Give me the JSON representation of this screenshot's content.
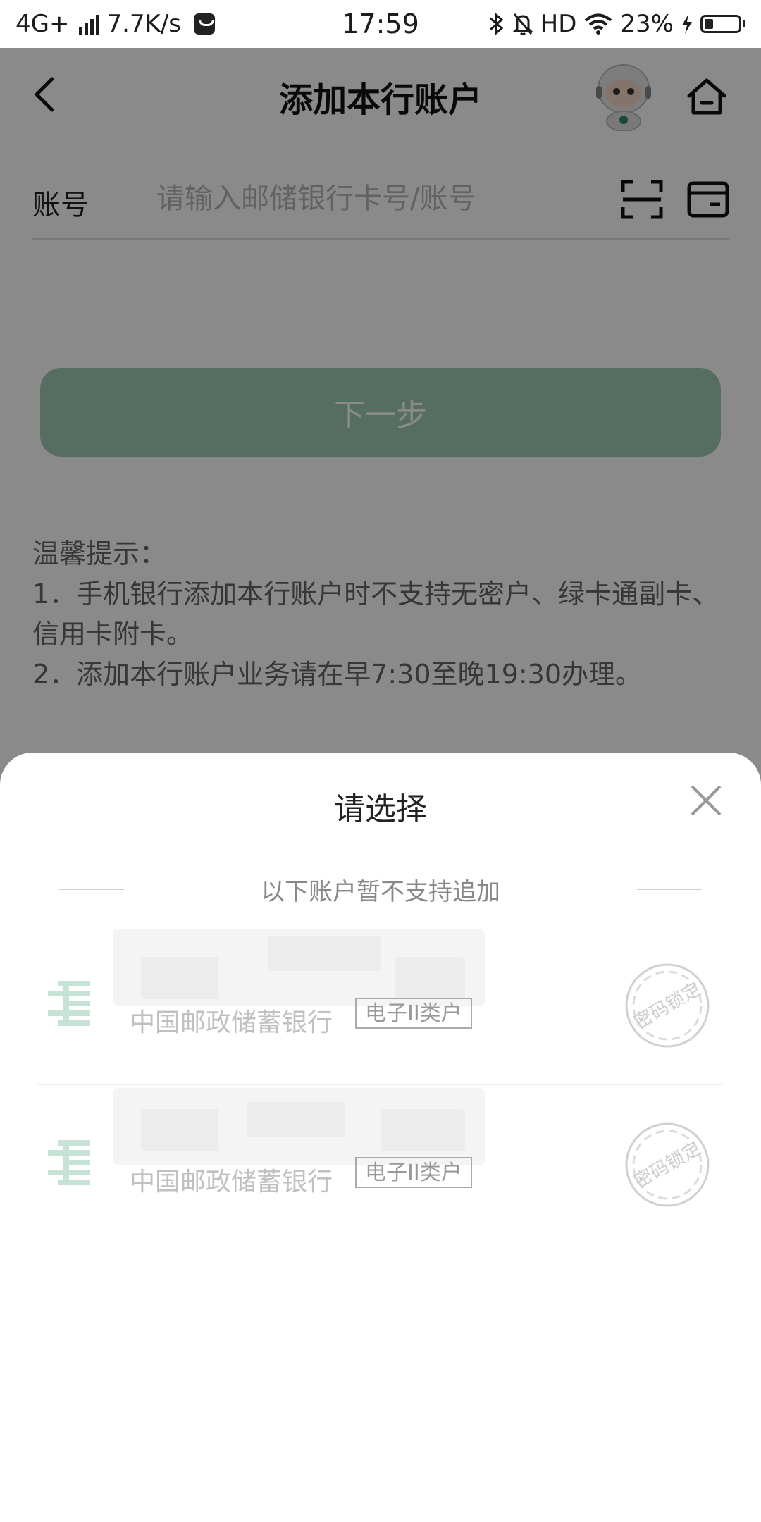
{
  "status_bar": {
    "network": "4G+",
    "speed": "7.7K/s",
    "time": "17:59",
    "hd": "HD",
    "battery": "23%",
    "icons": [
      "signal-icon",
      "message-icon",
      "bluetooth-icon",
      "mute-icon",
      "wifi-icon",
      "charging-icon",
      "battery-icon"
    ]
  },
  "header": {
    "title": "添加本行账户",
    "back_icon": "chevron-left-icon",
    "assistant_icon": "robot-assistant-icon",
    "home_icon": "home-icon"
  },
  "account_field": {
    "label": "账号",
    "placeholder": "请输入邮储银行卡号/账号",
    "value": "",
    "scan_icon": "scan-icon",
    "card_icon": "card-icon"
  },
  "next_button": {
    "label": "下一步",
    "enabled": false
  },
  "tips": {
    "title": "温馨提示：",
    "lines": [
      "1．手机银行添加本行账户时不支持无密户、绿卡通副卡、信用卡附卡。",
      "2．添加本行账户业务请在早7:30至晚19:30办理。"
    ]
  },
  "sheet": {
    "title": "请选择",
    "close_icon": "close-icon",
    "notice": "以下账户暂不支持追加",
    "accounts": [
      {
        "bank": "中国邮政储蓄银行",
        "type": "电子II类户",
        "status": "密码锁定"
      },
      {
        "bank": "中国邮政储蓄银行",
        "type": "电子II类户",
        "status": "密码锁定"
      }
    ]
  },
  "colors": {
    "brand_green": "#2e8b57",
    "button_disabled": "#9fcab3",
    "overlay": "rgba(0,0,0,0.46)"
  }
}
